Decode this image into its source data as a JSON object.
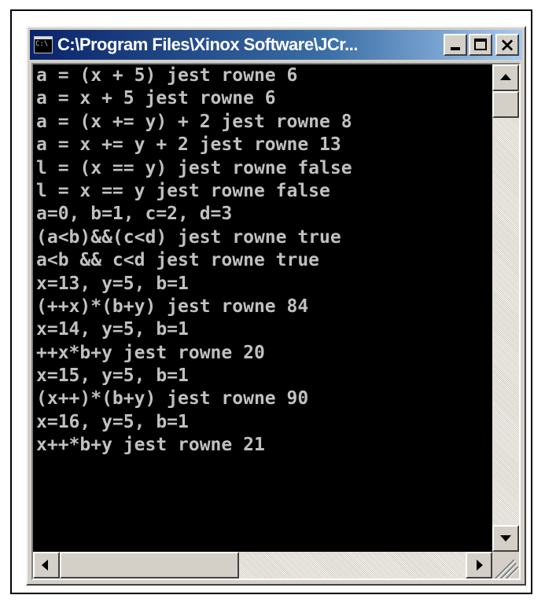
{
  "window": {
    "title": "C:\\Program Files\\Xinox Software\\JCr...",
    "icon": "console-icon",
    "icon_text": "C:\\",
    "buttons": {
      "minimize": "minimize-icon",
      "maximize": "maximize-icon",
      "close": "×"
    }
  },
  "console": {
    "lines": [
      "a = (x + 5) jest rowne 6",
      "a = x + 5 jest rowne 6",
      "a = (x += y) + 2 jest rowne 8",
      "a = x += y + 2 jest rowne 13",
      "l = (x == y) jest rowne false",
      "l = x == y jest rowne false",
      "a=0, b=1, c=2, d=3",
      "(a<b)&&(c<d) jest rowne true",
      "a<b && c<d jest rowne true",
      "x=13, y=5, b=1",
      "(++x)*(b+y) jest rowne 84",
      "x=14, y=5, b=1",
      "++x*b+y jest rowne 20",
      "x=15, y=5, b=1",
      "(x++)*(b+y) jest rowne 90",
      "x=16, y=5, b=1",
      "x++*b+y jest rowne 21"
    ],
    "colors": {
      "background": "#000000",
      "text": "#c0c0c0"
    }
  },
  "scrollbars": {
    "vertical": {
      "up": "arrow-up-icon",
      "down": "arrow-down-icon"
    },
    "horizontal": {
      "left": "arrow-left-icon",
      "right": "arrow-right-icon"
    }
  }
}
